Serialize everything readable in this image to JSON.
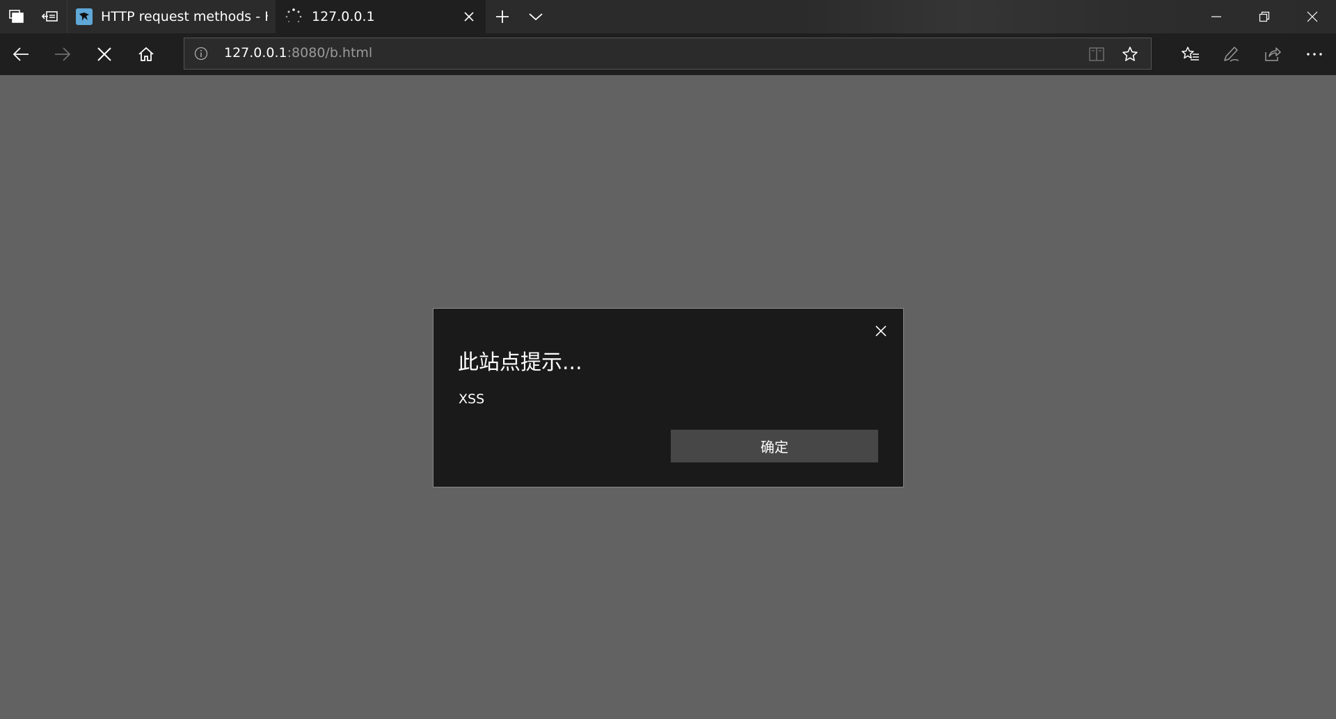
{
  "tabs": [
    {
      "title": "HTTP request methods - HT",
      "favicon": "mdn-dino-icon",
      "state": "inactive"
    },
    {
      "title": "127.0.0.1",
      "favicon": "loading-spinner-icon",
      "state": "active"
    }
  ],
  "titlebar": {
    "left_buttons": [
      "tabs-aside-icon",
      "set-tabs-aside-icon"
    ],
    "right_buttons": [
      "new-tab-icon",
      "tab-list-chevron-icon"
    ],
    "window_controls": [
      "minimize-icon",
      "restore-icon",
      "close-icon"
    ]
  },
  "navbar": {
    "buttons": [
      "back-arrow-icon",
      "forward-arrow-icon",
      "stop-loading-icon",
      "home-icon"
    ],
    "address": {
      "host": "127.0.0.1",
      "rest": ":8080/b.html"
    },
    "address_icons": [
      "site-info-icon",
      "reading-view-icon",
      "favorite-star-icon"
    ],
    "right_buttons": [
      "favorites-hub-icon",
      "web-note-icon",
      "share-icon",
      "more-ellipsis-icon"
    ]
  },
  "dialog": {
    "title": "此站点提示...",
    "message": "XSS",
    "ok_label": "确定"
  },
  "colors": {
    "page_background": "#626262",
    "chrome_dark": "#1f1f1f",
    "titlebar": "#2b2b2b",
    "dialog_background": "#1a1a1a",
    "button_background": "#474747",
    "url_muted": "#9a9a9a"
  }
}
